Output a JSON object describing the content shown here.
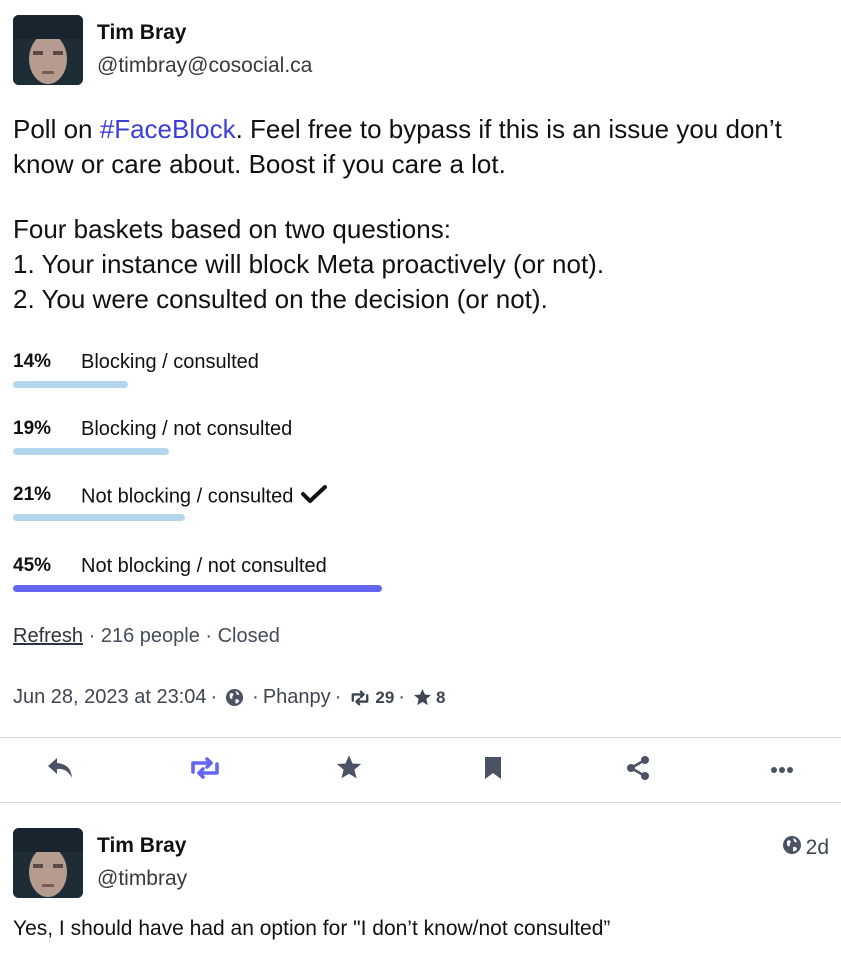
{
  "post": {
    "author": {
      "display_name": "Tim Bray",
      "handle": "@timbray@cosocial.ca"
    },
    "content": {
      "para1_before": "Poll on ",
      "hashtag": "#FaceBlock",
      "para1_after": ". Feel free to bypass if this is an issue you don’t know or care about.  Boost if you care a lot.",
      "para2_line1": "Four baskets based on two questions:",
      "para2_line2": "1. Your instance will block Meta proactively (or not).",
      "para2_line3": "2. You were consulted on the decision (or not)."
    },
    "poll": {
      "options": [
        {
          "percent": "14%",
          "percent_value": 14,
          "label": "Blocking / consulted",
          "voted": false,
          "winner": false
        },
        {
          "percent": "19%",
          "percent_value": 19,
          "label": "Blocking / not consulted",
          "voted": false,
          "winner": false
        },
        {
          "percent": "21%",
          "percent_value": 21,
          "label": "Not blocking / consulted",
          "voted": true,
          "winner": false
        },
        {
          "percent": "45%",
          "percent_value": 45,
          "label": "Not blocking / not consulted",
          "voted": false,
          "winner": true
        }
      ],
      "refresh_label": "Refresh",
      "voters": "216 people",
      "status": "Closed",
      "separator": "·"
    },
    "meta": {
      "timestamp": "Jun 28, 2023 at 23:04",
      "app": "Phanpy",
      "boosts": "29",
      "favourites": "8",
      "separator": "·"
    },
    "actions": {
      "reply_icon": "reply-icon",
      "boost_icon": "boost-icon",
      "favourite_icon": "star-icon",
      "bookmark_icon": "bookmark-icon",
      "share_icon": "share-icon",
      "more_icon": "more-icon"
    }
  },
  "reply": {
    "author": {
      "display_name": "Tim Bray",
      "handle": "@timbray"
    },
    "age": "2d",
    "text": "Yes, I should have had an option for \"I don’t know/not consulted”"
  },
  "colors": {
    "accent": "#6366f1",
    "bar": "#b3d6ec",
    "hashtag": "#3d3dd8",
    "icon": "#4a5263"
  }
}
